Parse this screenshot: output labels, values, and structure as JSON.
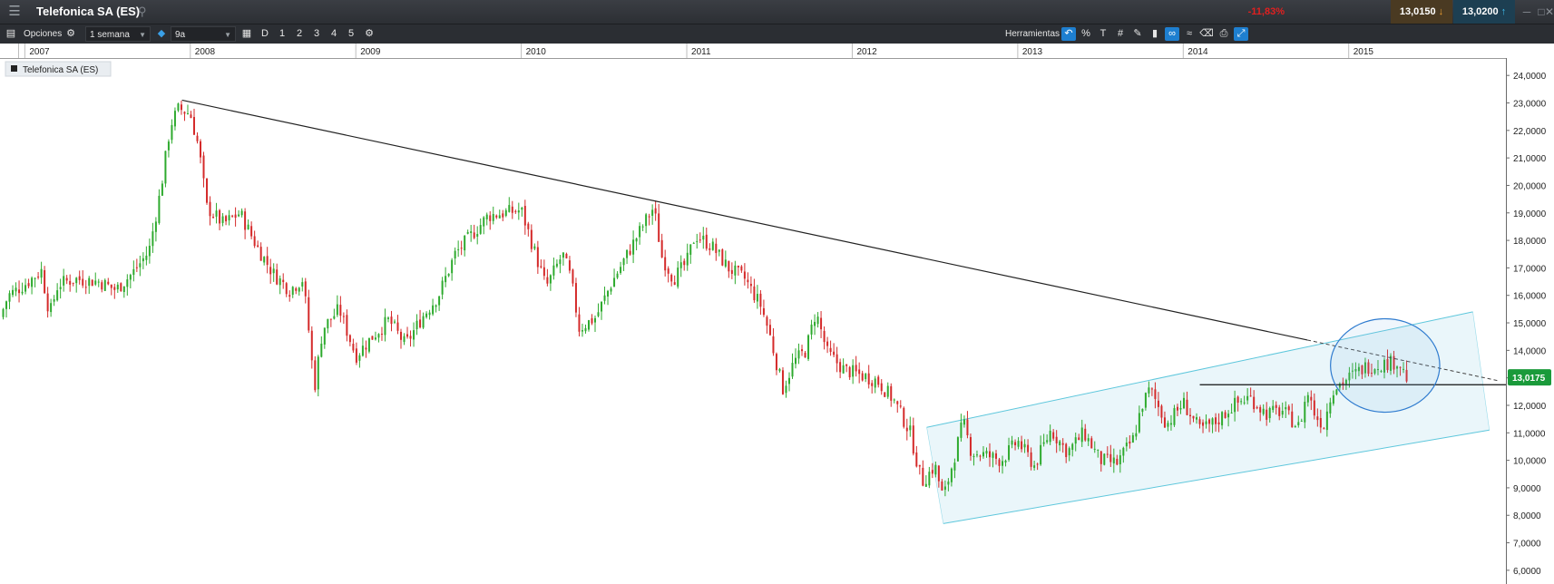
{
  "header": {
    "title": "Telefonica SA (ES)",
    "change": "-11,83%",
    "bid": "13,0150",
    "ask": "13,0200"
  },
  "toolbar": {
    "options_label": "Opciones",
    "interval": "1 semana",
    "range": "9a",
    "period_buttons": [
      "D",
      "1",
      "2",
      "3",
      "4",
      "5"
    ],
    "tools_label": "Herramientas",
    "percent_symbol": "%"
  },
  "colors": {
    "up": "#2eaa2e",
    "down": "#d42a2a",
    "channel_line": "#5ec7dc",
    "channel_fill": "#e3f3f8",
    "circle": "#2e7bcf",
    "last_price_bg": "#1a9a3a",
    "accent": "#1e7fd0"
  },
  "chart_data": {
    "type": "candlestick",
    "legend": "Telefonica SA (ES)",
    "last_price": "13,0175",
    "x_axis_labels": [
      "2007",
      "2008",
      "2009",
      "2010",
      "2011",
      "2012",
      "2013",
      "2014",
      "2015"
    ],
    "y_ticks": [
      "6,0000",
      "7,0000",
      "8,0000",
      "9,0000",
      "10,0000",
      "11,0000",
      "12,0000",
      "13,0000",
      "14,0000",
      "15,0000",
      "16,0000",
      "17,0000",
      "18,0000",
      "19,0000",
      "20,0000",
      "21,0000",
      "22,0000",
      "23,0000",
      "24,0000"
    ],
    "ylim": [
      5.6,
      24.6
    ],
    "xlim": [
      2006.85,
      2015.95
    ],
    "legend_position": "top-left",
    "anchors": [
      [
        2006.85,
        15.2
      ],
      [
        2006.9,
        16.0
      ],
      [
        2007.0,
        16.4
      ],
      [
        2007.1,
        16.9
      ],
      [
        2007.15,
        15.3
      ],
      [
        2007.2,
        16.4
      ],
      [
        2007.3,
        16.6
      ],
      [
        2007.45,
        16.5
      ],
      [
        2007.55,
        16.2
      ],
      [
        2007.65,
        16.8
      ],
      [
        2007.75,
        17.6
      ],
      [
        2007.82,
        19.8
      ],
      [
        2007.88,
        22.2
      ],
      [
        2007.93,
        22.8
      ],
      [
        2008.0,
        22.6
      ],
      [
        2008.05,
        21.4
      ],
      [
        2008.1,
        19.2
      ],
      [
        2008.2,
        18.6
      ],
      [
        2008.3,
        19.0
      ],
      [
        2008.4,
        17.8
      ],
      [
        2008.5,
        16.8
      ],
      [
        2008.6,
        16.2
      ],
      [
        2008.68,
        16.6
      ],
      [
        2008.72,
        14.5
      ],
      [
        2008.75,
        12.6
      ],
      [
        2008.8,
        14.8
      ],
      [
        2008.9,
        15.5
      ],
      [
        2009.0,
        13.8
      ],
      [
        2009.1,
        14.5
      ],
      [
        2009.2,
        15.1
      ],
      [
        2009.3,
        14.2
      ],
      [
        2009.4,
        15.2
      ],
      [
        2009.5,
        16.0
      ],
      [
        2009.6,
        17.5
      ],
      [
        2009.7,
        18.2
      ],
      [
        2009.8,
        18.9
      ],
      [
        2009.9,
        19.0
      ],
      [
        2010.0,
        19.1
      ],
      [
        2010.08,
        17.6
      ],
      [
        2010.15,
        16.3
      ],
      [
        2010.25,
        17.5
      ],
      [
        2010.3,
        16.6
      ],
      [
        2010.35,
        14.8
      ],
      [
        2010.45,
        15.2
      ],
      [
        2010.55,
        16.5
      ],
      [
        2010.65,
        17.6
      ],
      [
        2010.75,
        18.7
      ],
      [
        2010.8,
        19.2
      ],
      [
        2010.85,
        17.4
      ],
      [
        2010.92,
        16.6
      ],
      [
        2011.0,
        17.2
      ],
      [
        2011.05,
        18.2
      ],
      [
        2011.15,
        17.8
      ],
      [
        2011.25,
        17.0
      ],
      [
        2011.35,
        16.6
      ],
      [
        2011.45,
        15.6
      ],
      [
        2011.5,
        14.6
      ],
      [
        2011.58,
        12.6
      ],
      [
        2011.65,
        13.6
      ],
      [
        2011.72,
        14.0
      ],
      [
        2011.78,
        15.4
      ],
      [
        2011.85,
        13.9
      ],
      [
        2011.95,
        13.3
      ],
      [
        2012.05,
        13.1
      ],
      [
        2012.15,
        12.9
      ],
      [
        2012.25,
        12.2
      ],
      [
        2012.35,
        11.0
      ],
      [
        2012.42,
        9.2
      ],
      [
        2012.5,
        9.8
      ],
      [
        2012.55,
        8.6
      ],
      [
        2012.62,
        10.2
      ],
      [
        2012.67,
        11.4
      ],
      [
        2012.72,
        10.3
      ],
      [
        2012.8,
        10.2
      ],
      [
        2012.9,
        10.0
      ],
      [
        2013.0,
        10.7
      ],
      [
        2013.1,
        9.8
      ],
      [
        2013.2,
        11.1
      ],
      [
        2013.3,
        10.3
      ],
      [
        2013.4,
        11.0
      ],
      [
        2013.5,
        10.0
      ],
      [
        2013.6,
        9.9
      ],
      [
        2013.7,
        10.8
      ],
      [
        2013.75,
        12.0
      ],
      [
        2013.8,
        12.6
      ],
      [
        2013.9,
        11.3
      ],
      [
        2014.0,
        12.1
      ],
      [
        2014.1,
        11.1
      ],
      [
        2014.2,
        11.4
      ],
      [
        2014.3,
        12.0
      ],
      [
        2014.4,
        12.3
      ],
      [
        2014.5,
        11.7
      ],
      [
        2014.6,
        11.8
      ],
      [
        2014.7,
        11.2
      ],
      [
        2014.75,
        12.5
      ],
      [
        2014.8,
        11.6
      ],
      [
        2014.85,
        11.3
      ],
      [
        2014.9,
        12.6
      ],
      [
        2015.0,
        13.0
      ],
      [
        2015.1,
        13.4
      ],
      [
        2015.2,
        13.5
      ],
      [
        2015.3,
        13.6
      ],
      [
        2015.35,
        13.0
      ]
    ],
    "annotations": [
      {
        "type": "trendline",
        "from": [
          2007.95,
          23.1
        ],
        "to": [
          2015.9,
          12.9
        ],
        "solid_until": 2014.75
      },
      {
        "type": "channel",
        "upper": [
          [
            2012.45,
            11.2
          ],
          [
            2015.75,
            15.4
          ]
        ],
        "lower": [
          [
            2012.55,
            7.7
          ],
          [
            2015.85,
            11.1
          ]
        ]
      },
      {
        "type": "horizontal",
        "y": 12.75,
        "x": [
          2014.1,
          2015.95
        ]
      },
      {
        "type": "circle",
        "center": [
          2015.22,
          13.45
        ],
        "rx": 0.33,
        "ry": 1.7
      }
    ]
  }
}
